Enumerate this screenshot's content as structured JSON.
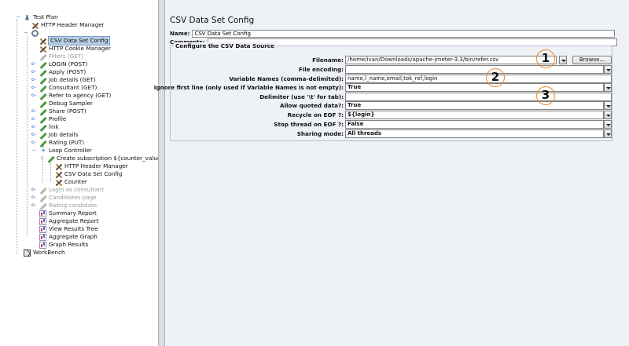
{
  "tree": {
    "items": [
      {
        "label": "Test Plan",
        "icon": "flask-icon",
        "disabled": false,
        "selected": false
      },
      {
        "label": "HTTP Header Manager",
        "icon": "wrench-icon",
        "disabled": false,
        "selected": false
      },
      {
        "label": "",
        "icon": "thread-group-gear-icon",
        "disabled": false,
        "selected": false
      },
      {
        "label": "CSV Data Set Config",
        "icon": "wrench-icon",
        "disabled": false,
        "selected": true
      },
      {
        "label": "HTTP Cookie Manager",
        "icon": "wrench-icon",
        "disabled": false,
        "selected": false
      },
      {
        "label": "Filters (GET)",
        "icon": "sampler-pen-icon",
        "disabled": true,
        "selected": false
      },
      {
        "label": "LOGIN (POST)",
        "icon": "sampler-pen-icon",
        "disabled": false,
        "selected": false
      },
      {
        "label": "Apply (POST)",
        "icon": "sampler-pen-icon",
        "disabled": false,
        "selected": false
      },
      {
        "label": "Job details (GET)",
        "icon": "sampler-pen-icon",
        "disabled": false,
        "selected": false
      },
      {
        "label": "Consultant (GET)",
        "icon": "sampler-pen-icon",
        "disabled": false,
        "selected": false
      },
      {
        "label": "Refer to agency (GET)",
        "icon": "sampler-pen-icon",
        "disabled": false,
        "selected": false
      },
      {
        "label": "Debug Sampler",
        "icon": "sampler-pen-icon",
        "disabled": false,
        "selected": false
      },
      {
        "label": "Share (POST)",
        "icon": "sampler-pen-icon",
        "disabled": false,
        "selected": false
      },
      {
        "label": "Profile",
        "icon": "sampler-pen-icon",
        "disabled": false,
        "selected": false
      },
      {
        "label": "link",
        "icon": "sampler-pen-icon",
        "disabled": false,
        "selected": false
      },
      {
        "label": "Job details",
        "icon": "sampler-pen-icon",
        "disabled": false,
        "selected": false
      },
      {
        "label": "Rating (PUT)",
        "icon": "sampler-pen-icon",
        "disabled": false,
        "selected": false
      },
      {
        "label": "Loop Controller",
        "icon": "loop-controller-icon",
        "disabled": false,
        "selected": false
      },
      {
        "label": "Create subscription ${counter_value}",
        "icon": "sampler-pen-icon",
        "disabled": false,
        "selected": false
      },
      {
        "label": "HTTP Header Manager",
        "icon": "wrench-icon",
        "disabled": false,
        "selected": false
      },
      {
        "label": "CSV Data Set Config",
        "icon": "wrench-icon",
        "disabled": false,
        "selected": false
      },
      {
        "label": "Counter",
        "icon": "wrench-icon",
        "disabled": false,
        "selected": false
      },
      {
        "label": "Login as consultant",
        "icon": "sampler-pen-icon",
        "disabled": true,
        "selected": false
      },
      {
        "label": "Candidates page",
        "icon": "sampler-pen-icon",
        "disabled": true,
        "selected": false
      },
      {
        "label": "Rating candidate",
        "icon": "sampler-pen-icon",
        "disabled": true,
        "selected": false
      },
      {
        "label": "Summary Report",
        "icon": "listener-chart-icon",
        "disabled": false,
        "selected": false
      },
      {
        "label": "Aggregate Report",
        "icon": "listener-chart-icon",
        "disabled": false,
        "selected": false
      },
      {
        "label": "View Results Tree",
        "icon": "listener-chart-icon",
        "disabled": false,
        "selected": false
      },
      {
        "label": "Aggregate Graph",
        "icon": "listener-chart-icon",
        "disabled": false,
        "selected": false
      },
      {
        "label": "Graph Results",
        "icon": "listener-chart-icon",
        "disabled": false,
        "selected": false
      },
      {
        "label": "WorkBench",
        "icon": "workbench-icon",
        "disabled": false,
        "selected": false
      }
    ]
  },
  "panel": {
    "title": "CSV Data Set Config",
    "name_label": "Name:",
    "name_value": "CSV Data Set Config",
    "comments_label": "Comments:",
    "comments_value": "",
    "section_title": "Configure the CSV Data Source",
    "browse_label": "Browse...",
    "rows": [
      {
        "label": "Filename:",
        "value": "/home/ivan/Downloads/apache-jmeter-3.3/bin/refer.csv",
        "kind": "combo"
      },
      {
        "label": "File encoding:",
        "value": "",
        "kind": "combo"
      },
      {
        "label": "Variable Names (comma-delimited):",
        "value": "name,l_name,email,tok_ref,login",
        "kind": "text"
      },
      {
        "label": "Ignore first line (only used if Variable Names is not empty):",
        "value": "True",
        "kind": "combo"
      },
      {
        "label": "Delimiter (use '\\t' for tab):",
        "value": "",
        "kind": "text"
      },
      {
        "label": "Allow quoted data?:",
        "value": "True",
        "kind": "combo"
      },
      {
        "label": "Recycle on EOF ?:",
        "value": "${login}",
        "kind": "combo"
      },
      {
        "label": "Stop thread on EOF ?:",
        "value": "False",
        "kind": "combo"
      },
      {
        "label": "Sharing mode:",
        "value": "All threads",
        "kind": "combo"
      }
    ]
  },
  "callouts": [
    "1",
    "2",
    "3"
  ],
  "colors": {
    "callout_ring": "#ee8a1e",
    "selection": "#b8cfe5",
    "panel_bg": "#eef1f6"
  }
}
